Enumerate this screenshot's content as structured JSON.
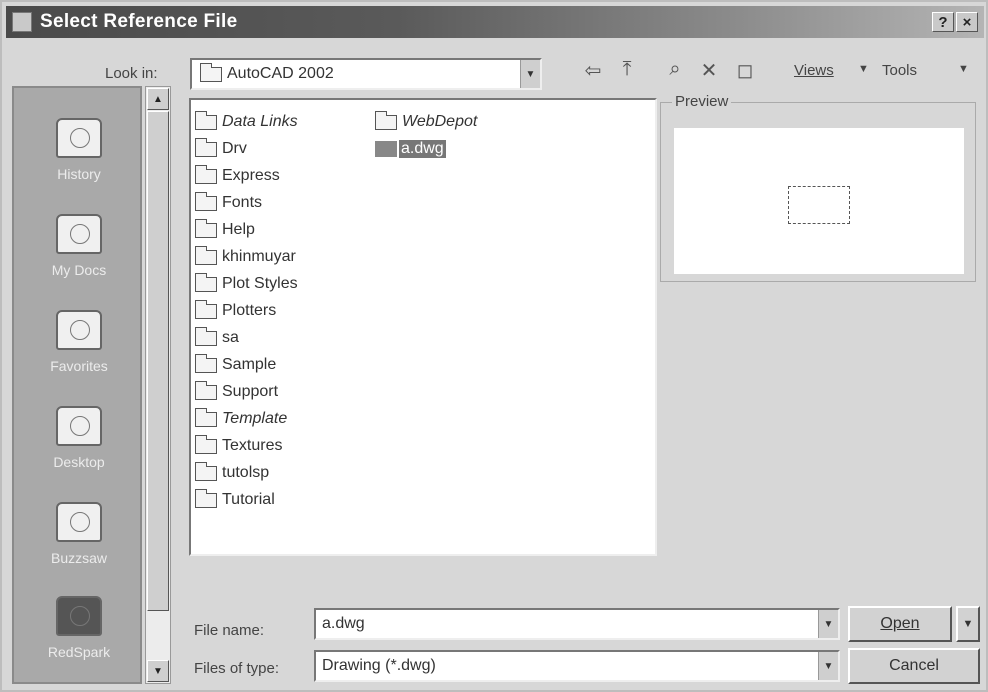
{
  "window": {
    "title": "Select Reference File",
    "help": "?",
    "close": "×"
  },
  "lookin": {
    "label": "Look in:",
    "value": "AutoCAD 2002"
  },
  "toolbar": {
    "back": "⇦",
    "up": "⤒",
    "search": "⌕",
    "delete": "✕",
    "newfolder": "◻",
    "views": "Views",
    "tools": "Tools"
  },
  "sidebar": {
    "items": [
      {
        "label": "History",
        "icon": "history-icon"
      },
      {
        "label": "My Docs",
        "icon": "my-documents-icon"
      },
      {
        "label": "Favorites",
        "icon": "favorites-icon"
      },
      {
        "label": "Desktop",
        "icon": "desktop-icon"
      },
      {
        "label": "Buzzsaw",
        "icon": "buzzsaw-icon"
      },
      {
        "label": "RedSpark",
        "icon": "redspark-icon"
      }
    ]
  },
  "files": [
    {
      "name": "Data Links",
      "italic": true,
      "type": "folder"
    },
    {
      "name": "Drv",
      "type": "folder"
    },
    {
      "name": "Express",
      "type": "folder"
    },
    {
      "name": "Fonts",
      "type": "folder"
    },
    {
      "name": "Help",
      "type": "folder"
    },
    {
      "name": "khinmuyar",
      "type": "folder"
    },
    {
      "name": "Plot Styles",
      "type": "folder"
    },
    {
      "name": "Plotters",
      "type": "folder"
    },
    {
      "name": "sa",
      "type": "folder"
    },
    {
      "name": "Sample",
      "type": "folder"
    },
    {
      "name": "Support",
      "type": "folder"
    },
    {
      "name": "Template",
      "italic": true,
      "type": "folder"
    },
    {
      "name": "Textures",
      "type": "folder"
    },
    {
      "name": "tutolsp",
      "type": "folder"
    },
    {
      "name": "Tutorial",
      "type": "folder"
    },
    {
      "name": "WebDepot",
      "italic": true,
      "type": "folder"
    },
    {
      "name": "a.dwg",
      "type": "dwg",
      "selected": true
    }
  ],
  "preview": {
    "label": "Preview"
  },
  "filename": {
    "label": "File name:",
    "value": "a.dwg"
  },
  "filetype": {
    "label": "Files of type:",
    "value": "Drawing (*.dwg)"
  },
  "buttons": {
    "open": "Open",
    "cancel": "Cancel"
  }
}
